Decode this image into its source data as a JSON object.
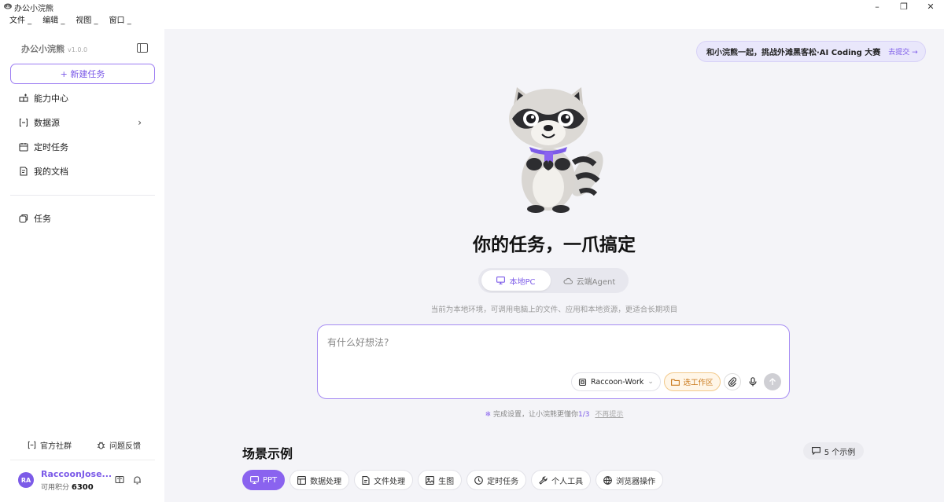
{
  "window": {
    "title": "办公小浣熊",
    "min": "–",
    "restore": "❐",
    "close": "✕"
  },
  "menu": [
    "文件 _",
    "编辑 _",
    "视图 _",
    "窗口 _"
  ],
  "sidebar": {
    "app_name": "办公小浣熊",
    "version": "v1.0.0",
    "new_task": "+ 新建任务",
    "nav": [
      {
        "label": "能力中心",
        "icon": "grid-plus-icon"
      },
      {
        "label": "数据源",
        "icon": "database-icon"
      },
      {
        "label": "定时任务",
        "icon": "calendar-icon"
      },
      {
        "label": "我的文档",
        "icon": "document-icon"
      }
    ],
    "tasks_label": "任务",
    "community": "官方社群",
    "feedback": "问题反馈",
    "user": {
      "initials": "RA",
      "name": "RaccoonJose...",
      "credits_label": "可用积分",
      "credits": "6300"
    }
  },
  "main": {
    "promo_text": "和小浣熊一起，挑战外滩黑客松·AI Coding 大赛",
    "promo_cta": "去提交 →",
    "hero_title": "你的任务，一爪搞定",
    "mode_local": "本地PC",
    "mode_cloud": "云端Agent",
    "env_hint": "当前为本地环境，可调用电脑上的文件、应用和本地资源，更适合长期项目",
    "input_placeholder": "有什么好想法?",
    "model": "Raccoon-Work",
    "workspace": "选工作区",
    "setup_hint": "完成设置，让小浣熊更懂你",
    "setup_progress": "1/3",
    "setup_dismiss": "不再提示",
    "scenes_title": "场景示例",
    "scenes_count": "5 个示例",
    "chips": [
      "PPT",
      "数据处理",
      "文件处理",
      "生图",
      "定时任务",
      "个人工具",
      "浏览器操作"
    ]
  },
  "colors": {
    "accent": "#7b5ae8",
    "accent_chip": "#8a63ef",
    "workspace": "#c9781a",
    "main_bg": "#f4f4f8"
  }
}
